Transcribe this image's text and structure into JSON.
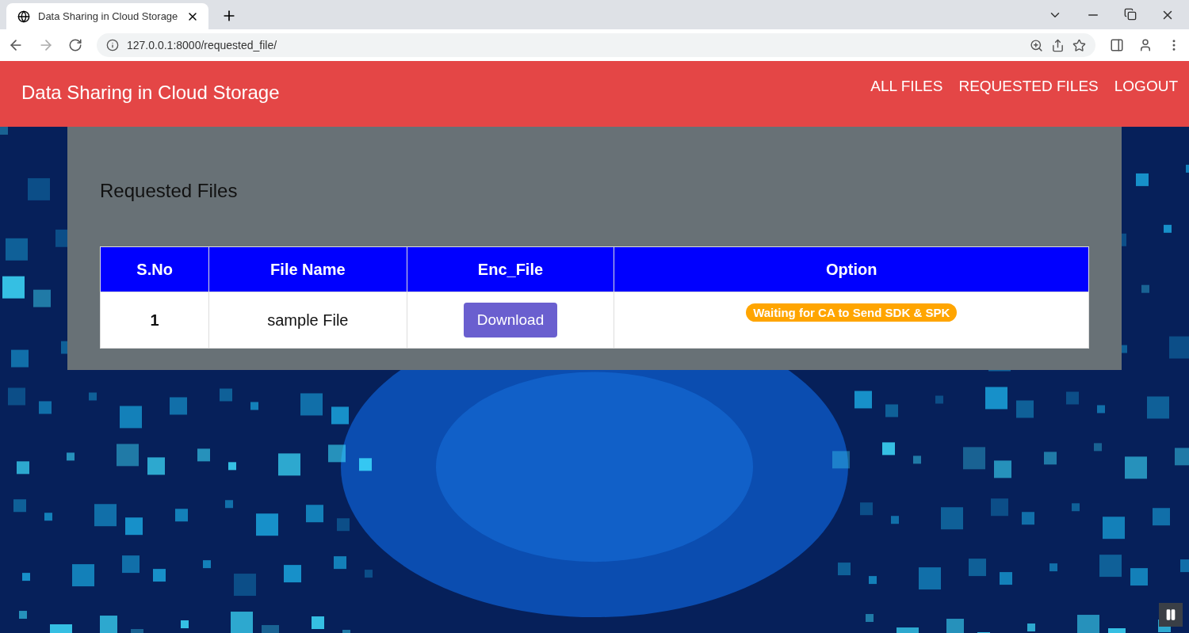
{
  "browser": {
    "tab_title": "Data Sharing in Cloud Storage",
    "address": "127.0.0.1:8000/requested_file/"
  },
  "navbar": {
    "brand": "Data Sharing in Cloud Storage",
    "links": [
      "ALL FILES",
      "REQUESTED FILES",
      "LOGOUT"
    ]
  },
  "panel": {
    "title": "Requested Files",
    "table": {
      "columns": [
        "S.No",
        "File Name",
        "Enc_File",
        "Option"
      ],
      "rows": [
        {
          "sno": "1",
          "file_name": "sample File",
          "button": "Download",
          "status": "Waiting for CA to Send SDK & SPK"
        }
      ]
    }
  }
}
